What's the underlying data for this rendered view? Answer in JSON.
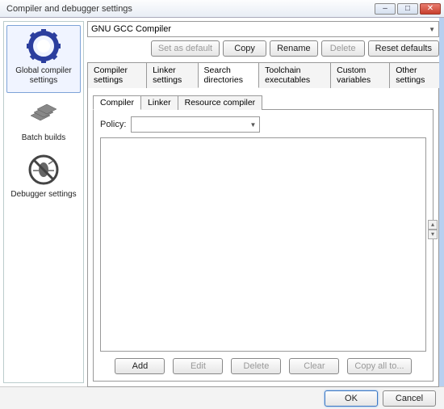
{
  "window": {
    "title": "Compiler and debugger settings"
  },
  "sidebar": {
    "items": [
      {
        "label": "Global compiler settings"
      },
      {
        "label": "Batch builds"
      },
      {
        "label": "Debugger settings"
      }
    ]
  },
  "compiler_select": {
    "value": "GNU GCC Compiler"
  },
  "toolbar": {
    "set_default": "Set as default",
    "copy": "Copy",
    "rename": "Rename",
    "delete": "Delete",
    "reset": "Reset defaults"
  },
  "tabs": [
    {
      "label": "Compiler settings"
    },
    {
      "label": "Linker settings"
    },
    {
      "label": "Search directories"
    },
    {
      "label": "Toolchain executables"
    },
    {
      "label": "Custom variables"
    },
    {
      "label": "Other settings"
    }
  ],
  "subtabs": [
    {
      "label": "Compiler"
    },
    {
      "label": "Linker"
    },
    {
      "label": "Resource compiler"
    }
  ],
  "policy": {
    "label": "Policy:",
    "value": ""
  },
  "list_buttons": {
    "add": "Add",
    "edit": "Edit",
    "delete": "Delete",
    "clear": "Clear",
    "copy_all": "Copy all to..."
  },
  "footer": {
    "ok": "OK",
    "cancel": "Cancel"
  }
}
